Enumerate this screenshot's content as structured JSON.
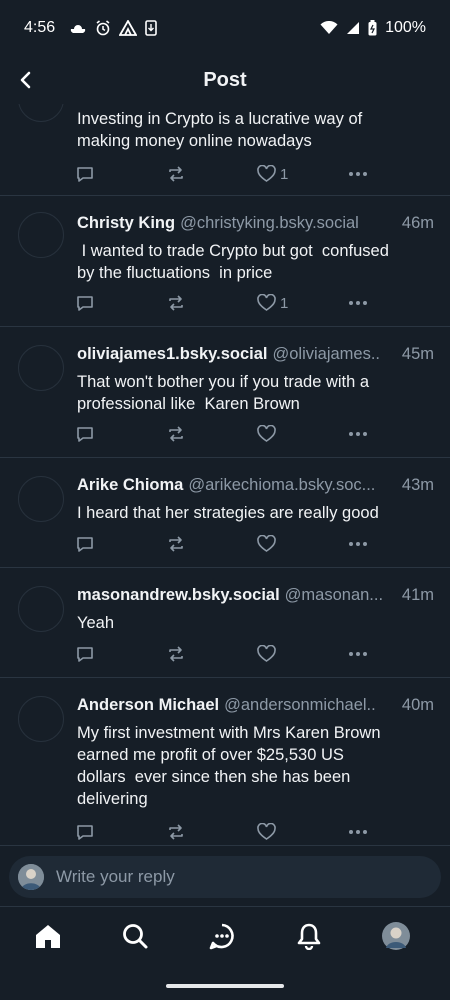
{
  "status_bar": {
    "time": "4:56",
    "battery": "100%"
  },
  "header": {
    "title": "Post"
  },
  "posts": [
    {
      "author": "",
      "handle": "",
      "time": "",
      "text": "Investing in Crypto is a lucrative way of\nmaking money online nowadays",
      "likes": "1"
    },
    {
      "author": "Christy King",
      "handle": "@christyking.bsky.social",
      "time": "46m",
      "text": " I wanted to trade Crypto but got  confused\nby the fluctuations  in price",
      "likes": "1"
    },
    {
      "author": "oliviajames1.bsky.social",
      "handle": "@oliviajames..",
      "time": "45m",
      "text": "That won't bother you if you trade with a\nprofessional like  Karen Brown",
      "likes": ""
    },
    {
      "author": "Arike Chioma",
      "handle": "@arikechioma.bsky.soc...",
      "time": "43m",
      "text": "I heard that her strategies are really good",
      "likes": ""
    },
    {
      "author": "masonandrew.bsky.social",
      "handle": "@masonan...",
      "time": "41m",
      "text": "Yeah",
      "likes": ""
    },
    {
      "author": "Anderson Michael",
      "handle": "@andersonmichael..",
      "time": "40m",
      "text": "My first investment with Mrs Karen Brown\nearned me profit of over $25,530 US\ndollars  ever since then she has been\ndelivering",
      "likes": ""
    }
  ],
  "reply": {
    "placeholder": "Write your reply"
  },
  "nav": {
    "icons": [
      "home-icon",
      "search-icon",
      "chat-icon",
      "bell-icon",
      "profile-avatar"
    ]
  },
  "colors": {
    "background": "#161e27",
    "text": "#f1f3f5",
    "muted": "#8d99a6",
    "divider": "#2a3541",
    "input": "#1f2a36"
  }
}
